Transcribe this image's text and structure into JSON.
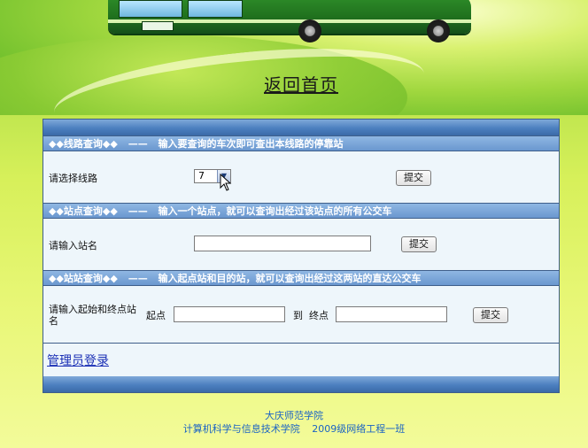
{
  "header": {
    "home_link": "返回首页"
  },
  "route_query": {
    "title": "◆◆线路查询◆◆",
    "separator": "——",
    "description": "输入要查询的车次即可查出本线路的停靠站",
    "label": "请选择线路",
    "selected_route": "7",
    "submit_label": "提交"
  },
  "station_query": {
    "title": "◆◆站点查询◆◆",
    "separator": "——",
    "description": "输入一个站点，就可以查询出经过该站点的所有公交车",
    "label": "请输入站名",
    "station_value": "",
    "submit_label": "提交"
  },
  "stop_to_stop_query": {
    "title": "◆◆站站查询◆◆",
    "separator": "——",
    "description": "输入起点站和目的站，就可以查询出经过这两站的直达公交车",
    "label": "请输入起始和终点站名",
    "from_label": "起点",
    "to_label": "到",
    "end_label": "终点",
    "from_value": "",
    "to_value": "",
    "submit_label": "提交"
  },
  "admin": {
    "login_link": "管理员登录"
  },
  "footer": {
    "line1": "大庆师范学院",
    "college": "计算机科学与信息技术学院",
    "class": "2009级网络工程一班"
  },
  "colors": {
    "panel_border": "#3f5f8a",
    "section_header": "#6a97cf",
    "link_blue": "#1a2fb5",
    "footer_text": "#1b63c4"
  }
}
